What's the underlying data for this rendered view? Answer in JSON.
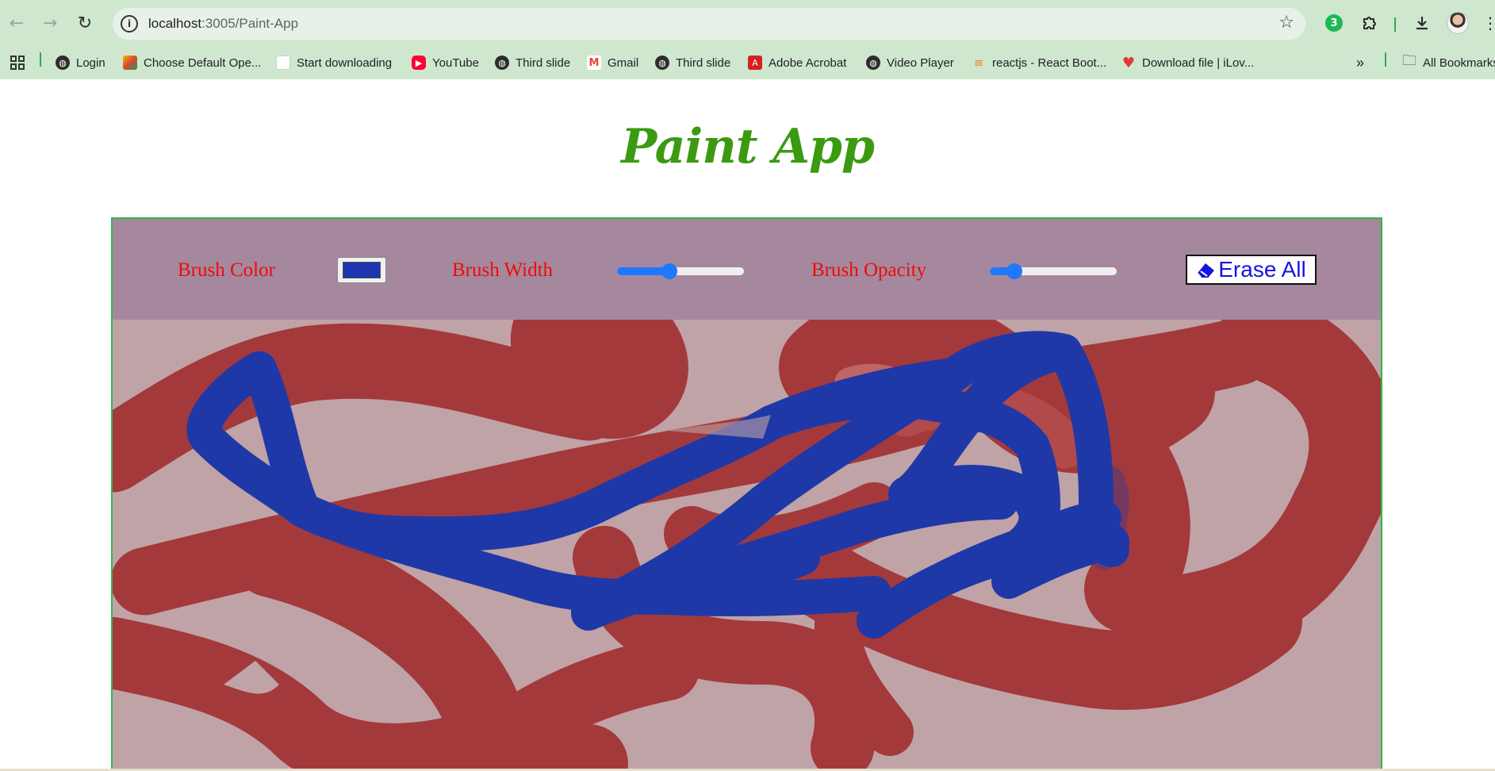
{
  "browser": {
    "url_host": "localhost",
    "url_path": ":3005/Paint-App",
    "extension_badge": "3",
    "bookmarks": [
      {
        "label": "Login",
        "icon": "globe-icon"
      },
      {
        "label": "Choose Default Ope...",
        "icon": "office-icon"
      },
      {
        "label": "Start downloading",
        "icon": "blank-page-icon"
      },
      {
        "label": "YouTube",
        "icon": "youtube-icon"
      },
      {
        "label": "Third slide",
        "icon": "globe-icon"
      },
      {
        "label": "Gmail",
        "icon": "gmail-icon"
      },
      {
        "label": "Third slide",
        "icon": "globe-icon"
      },
      {
        "label": "Adobe Acrobat",
        "icon": "acrobat-icon"
      },
      {
        "label": "Video Player",
        "icon": "globe-icon"
      },
      {
        "label": "reactjs - React Boot...",
        "icon": "stackoverflow-icon"
      },
      {
        "label": "Download file | iLov...",
        "icon": "heart-icon"
      }
    ],
    "overflow_chevron": "»",
    "all_bookmarks_label": "All Bookmarks"
  },
  "app": {
    "title": "Paint App",
    "brush_color_label": "Brush Color",
    "brush_color_value": "#1d35b0",
    "brush_width_label": "Brush Width",
    "brush_width_fraction": 0.4,
    "brush_opacity_label": "Brush Opacity",
    "brush_opacity_fraction": 0.15,
    "erase_all_label": "Erase All"
  },
  "colors": {
    "title_green": "#3b9a12",
    "controls_bg": "#a5889d",
    "canvas_bg": "#c0a3a6",
    "red_stroke": "#a3393b",
    "blue_stroke": "#1f38a8",
    "label_red": "#f00a0a",
    "frame_border": "#2fb84a"
  }
}
